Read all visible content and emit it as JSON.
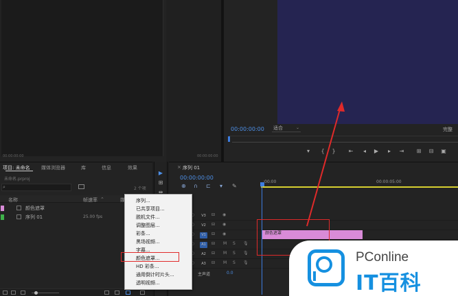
{
  "source_monitor": {
    "left_timecode": "00:00:00:00",
    "right_timecode": "00:00:00:00"
  },
  "program_monitor": {
    "timecode": "00:00:00:00",
    "fit": "适合",
    "resolution": "完整",
    "video_color": "#252451",
    "controls": [
      "mark-in",
      "mark-out",
      "go-to-in",
      "step-back",
      "play",
      "step-forward",
      "go-to-out",
      "lift",
      "extract",
      "export-frame"
    ]
  },
  "project_panel": {
    "tabs": [
      "项目: 未命名",
      "媒体浏览器",
      "库",
      "信息",
      "效果"
    ],
    "file": "未命名.prproj",
    "item_count": "2 个项",
    "columns": {
      "name": "名称",
      "fps": "帧速率",
      "media": "媒"
    },
    "items": [
      {
        "label": "颜色遮罩",
        "fps": "",
        "color": "#d98bd8"
      },
      {
        "label": "序列 01",
        "fps": "25.00 fps",
        "color": "#3fb14a"
      }
    ]
  },
  "timeline": {
    "sequence_tab": "序列 01",
    "timecode": "00:00:00:00",
    "time_start": ":00:00",
    "time_mid": "00:00:05:00",
    "tracks": [
      "V3",
      "V2",
      "V1",
      "A1",
      "A2",
      "A3"
    ],
    "master": "主声道",
    "master_value": "0.0",
    "clip_label": "颜色遮罩",
    "clip_color": "#d98bd8"
  },
  "context_menu": {
    "items": [
      "序列...",
      "已共享项目...",
      "脱机文件...",
      "调整图层...",
      "彩条...",
      "黑场视频...",
      "字幕...",
      "颜色遮罩...",
      "HD 彩条...",
      "通用倒计时片头...",
      "透明视频..."
    ],
    "highlighted_index": 7
  },
  "watermark": {
    "brand": "PConline",
    "title": "IT百科"
  }
}
